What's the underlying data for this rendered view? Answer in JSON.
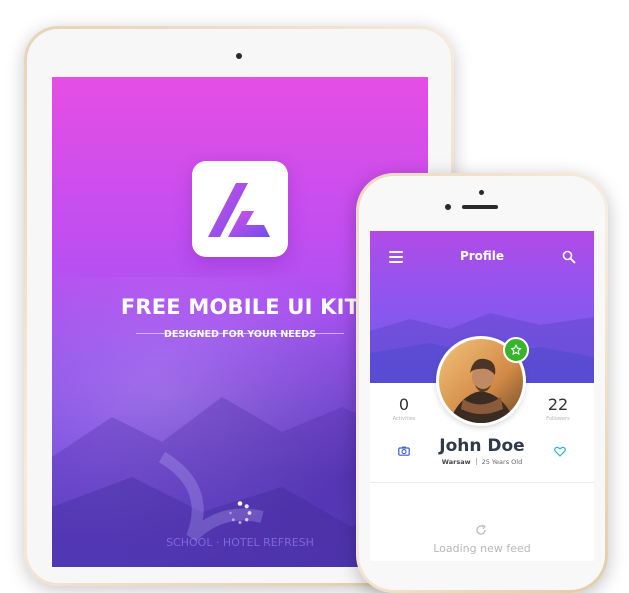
{
  "tablet": {
    "title": "FREE MOBILE UI KIT",
    "subtitle": "DESIGNED FOR YOUR NEEDS",
    "bottom_text": "SCHOOL · HOTEL REFRESH"
  },
  "phone": {
    "header": {
      "title": "Profile"
    },
    "profile": {
      "name": "John Doe",
      "city": "Warsaw",
      "age": "25 Years Old",
      "stats": [
        {
          "value": "0",
          "label": "Activities"
        },
        {
          "value": "22",
          "label": "Followers"
        }
      ]
    },
    "feed": {
      "loading_text": "Loading new feed"
    }
  },
  "colors": {
    "gradient_top": "#e64ee4",
    "gradient_bottom": "#7759ea",
    "badge_green": "#36b52b",
    "accent_cyan": "#2bb3d8"
  },
  "icons": [
    "app-logo-icon",
    "spinner-icon",
    "menu-icon",
    "search-icon",
    "star-icon",
    "camera-icon",
    "heart-icon",
    "refresh-icon"
  ]
}
